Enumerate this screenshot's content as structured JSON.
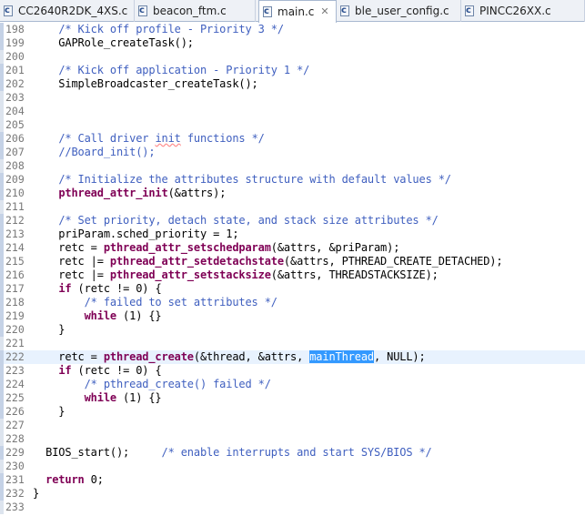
{
  "tabs": [
    {
      "label": "CC2640R2DK_4XS.c",
      "active": false
    },
    {
      "label": "beacon_ftm.c",
      "active": false
    },
    {
      "label": "main.c",
      "active": true
    },
    {
      "label": "ble_user_config.c",
      "active": false
    },
    {
      "label": "PINCC26XX.c",
      "active": false
    }
  ],
  "tab_icon_letter": "c",
  "close_glyph": "✕",
  "editor": {
    "highlighted_line": "222",
    "lines": [
      {
        "no": "198",
        "parts": [
          [
            "",
            "    "
          ],
          [
            "cm",
            "/* Kick off profile - Priority 3 */"
          ]
        ]
      },
      {
        "no": "199",
        "parts": [
          [
            "",
            "    GAPRole_createTask();"
          ]
        ]
      },
      {
        "no": "200",
        "parts": []
      },
      {
        "no": "201",
        "parts": [
          [
            "",
            "    "
          ],
          [
            "cm",
            "/* Kick off application - Priority 1 */"
          ]
        ]
      },
      {
        "no": "202",
        "parts": [
          [
            "",
            "    SimpleBroadcaster_createTask();"
          ]
        ]
      },
      {
        "no": "203",
        "parts": []
      },
      {
        "no": "204",
        "parts": []
      },
      {
        "no": "205",
        "parts": []
      },
      {
        "no": "206",
        "parts": [
          [
            "",
            "    "
          ],
          [
            "cm",
            "/* Call driver "
          ],
          [
            "cm squig",
            "init"
          ],
          [
            "cm",
            " functions */"
          ]
        ]
      },
      {
        "no": "207",
        "parts": [
          [
            "",
            "    "
          ],
          [
            "cm",
            "//Board_init();"
          ]
        ]
      },
      {
        "no": "208",
        "parts": []
      },
      {
        "no": "209",
        "parts": [
          [
            "",
            "    "
          ],
          [
            "cm",
            "/* Initialize the attributes structure with default values */"
          ]
        ]
      },
      {
        "no": "210",
        "parts": [
          [
            "",
            "    "
          ],
          [
            "fn",
            "pthread_attr_init"
          ],
          [
            "",
            "(&attrs);"
          ]
        ]
      },
      {
        "no": "211",
        "parts": []
      },
      {
        "no": "212",
        "parts": [
          [
            "",
            "    "
          ],
          [
            "cm",
            "/* Set priority, detach state, and stack size attributes */"
          ]
        ]
      },
      {
        "no": "213",
        "parts": [
          [
            "",
            "    priParam.sched_priority = 1;"
          ]
        ]
      },
      {
        "no": "214",
        "parts": [
          [
            "",
            "    retc = "
          ],
          [
            "fn",
            "pthread_attr_setschedparam"
          ],
          [
            "",
            "(&attrs, &priParam);"
          ]
        ]
      },
      {
        "no": "215",
        "parts": [
          [
            "",
            "    retc |= "
          ],
          [
            "fn",
            "pthread_attr_setdetachstate"
          ],
          [
            "",
            "(&attrs, PTHREAD_CREATE_DETACHED);"
          ]
        ]
      },
      {
        "no": "216",
        "parts": [
          [
            "",
            "    retc |= "
          ],
          [
            "fn",
            "pthread_attr_setstacksize"
          ],
          [
            "",
            "(&attrs, THREADSTACKSIZE);"
          ]
        ]
      },
      {
        "no": "217",
        "parts": [
          [
            "",
            "    "
          ],
          [
            "kw",
            "if"
          ],
          [
            "",
            " (retc != 0) {"
          ]
        ]
      },
      {
        "no": "218",
        "parts": [
          [
            "",
            "        "
          ],
          [
            "cm",
            "/* failed to set attributes */"
          ]
        ]
      },
      {
        "no": "219",
        "parts": [
          [
            "",
            "        "
          ],
          [
            "kw",
            "while"
          ],
          [
            "",
            " (1) {}"
          ]
        ]
      },
      {
        "no": "220",
        "parts": [
          [
            "",
            "    }"
          ]
        ]
      },
      {
        "no": "221",
        "parts": []
      },
      {
        "no": "222",
        "parts": [
          [
            "",
            "    retc = "
          ],
          [
            "fn",
            "pthread_create"
          ],
          [
            "",
            "(&thread, &attrs, "
          ],
          [
            "sel",
            "mainThread"
          ],
          [
            "",
            ", NULL);"
          ]
        ]
      },
      {
        "no": "223",
        "parts": [
          [
            "",
            "    "
          ],
          [
            "kw",
            "if"
          ],
          [
            "",
            " (retc != 0) {"
          ]
        ]
      },
      {
        "no": "224",
        "parts": [
          [
            "",
            "        "
          ],
          [
            "cm",
            "/* pthread_create() failed */"
          ]
        ]
      },
      {
        "no": "225",
        "parts": [
          [
            "",
            "        "
          ],
          [
            "kw",
            "while"
          ],
          [
            "",
            " (1) {}"
          ]
        ]
      },
      {
        "no": "226",
        "parts": [
          [
            "",
            "    }"
          ]
        ]
      },
      {
        "no": "227",
        "parts": []
      },
      {
        "no": "228",
        "parts": []
      },
      {
        "no": "229",
        "parts": [
          [
            "",
            "  BIOS_start();     "
          ],
          [
            "cm",
            "/* enable interrupts and start SYS/BIOS */"
          ]
        ]
      },
      {
        "no": "230",
        "parts": []
      },
      {
        "no": "231",
        "parts": [
          [
            "",
            "  "
          ],
          [
            "kw",
            "return"
          ],
          [
            "",
            " 0;"
          ]
        ]
      },
      {
        "no": "232",
        "parts": [
          [
            "",
            "}"
          ]
        ]
      },
      {
        "no": "233",
        "parts": []
      }
    ]
  }
}
